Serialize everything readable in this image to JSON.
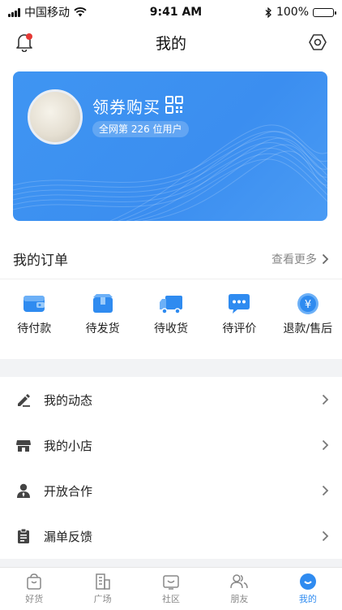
{
  "status": {
    "carrier": "中国移动",
    "time": "9:41 AM",
    "battery": "100%"
  },
  "nav": {
    "title": "我的"
  },
  "profile": {
    "name": "领券购买",
    "rank": "全网第 226 位用户"
  },
  "orders": {
    "title": "我的订单",
    "more": "查看更多",
    "items": [
      {
        "label": "待付款",
        "icon": "wallet-icon"
      },
      {
        "label": "待发货",
        "icon": "box-icon"
      },
      {
        "label": "待收货",
        "icon": "truck-icon"
      },
      {
        "label": "待评价",
        "icon": "comment-icon"
      },
      {
        "label": "退款/售后",
        "icon": "refund-icon"
      }
    ]
  },
  "menu": {
    "items": [
      {
        "label": "我的动态",
        "icon": "pen-icon"
      },
      {
        "label": "我的小店",
        "icon": "store-icon"
      },
      {
        "label": "开放合作",
        "icon": "person-icon"
      },
      {
        "label": "漏单反馈",
        "icon": "clipboard-icon"
      }
    ]
  },
  "tabbar": {
    "items": [
      {
        "label": "好货",
        "icon": "bag-icon"
      },
      {
        "label": "广场",
        "icon": "building-icon"
      },
      {
        "label": "社区",
        "icon": "tv-icon"
      },
      {
        "label": "朋友",
        "icon": "friends-icon"
      },
      {
        "label": "我的",
        "icon": "me-icon"
      }
    ],
    "active_index": 4
  },
  "colors": {
    "accent": "#2f8bf0",
    "card": "#3b8ef0",
    "badge": "#e53935"
  }
}
